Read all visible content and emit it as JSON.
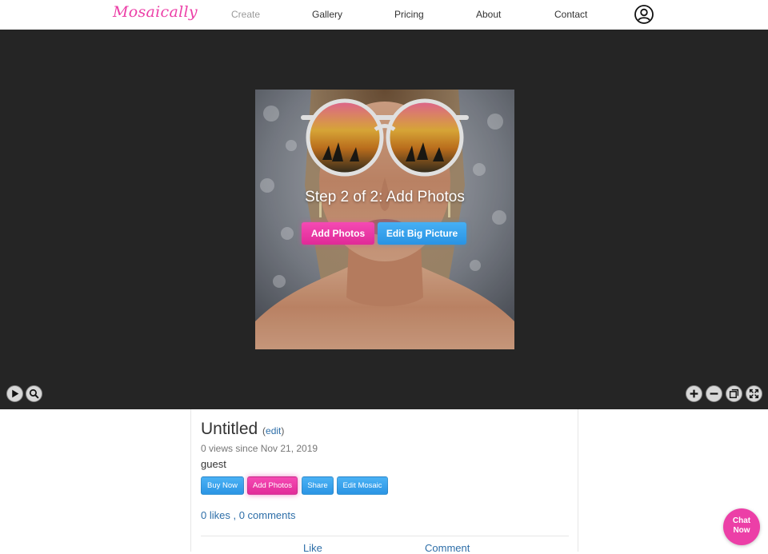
{
  "nav": {
    "logo": "Mosaically",
    "links": [
      "Create",
      "Gallery",
      "Pricing",
      "About",
      "Contact"
    ],
    "active": "Create"
  },
  "overlay": {
    "step_title": "Step 2 of 2: Add Photos",
    "add_photos_label": "Add Photos",
    "edit_big_picture_label": "Edit Big Picture"
  },
  "viewer_controls": {
    "left": [
      "play-icon",
      "magnifier-icon"
    ],
    "right": [
      "zoom-in-icon",
      "zoom-out-icon",
      "copy-icon",
      "fullscreen-icon"
    ]
  },
  "mosaic": {
    "title": "Untitled",
    "edit_link": "edit",
    "views_text": "0 views since Nov 21, 2019",
    "owner": "guest",
    "buttons": {
      "buy_now": "Buy Now",
      "add_photos": "Add Photos",
      "share": "Share",
      "edit_mosaic": "Edit Mosaic"
    },
    "likes": "0 likes",
    "separator": " , ",
    "comments": "0 comments",
    "like_action": "Like",
    "comment_action": "Comment"
  },
  "chat": {
    "line1": "Chat",
    "line2": "Now"
  },
  "colors": {
    "brand_pink": "#ec3fa7",
    "button_blue": "#2a93e3",
    "link_blue": "#2d6ea8",
    "viewer_bg": "#252525"
  }
}
